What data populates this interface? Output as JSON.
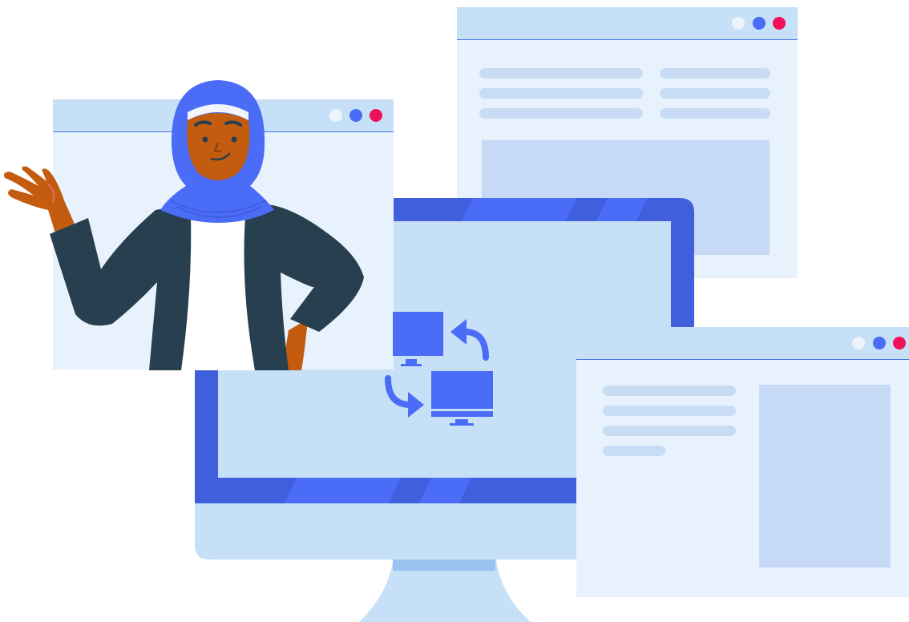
{
  "scene": {
    "windows": [
      {
        "name": "back-right-window",
        "controls": [
          "light-dot",
          "blue-dot",
          "red-dot"
        ]
      },
      {
        "name": "presenter-window",
        "controls": [
          "light-dot",
          "blue-dot",
          "red-dot"
        ]
      },
      {
        "name": "front-right-window",
        "controls": [
          "light-dot",
          "blue-dot",
          "red-dot"
        ]
      }
    ],
    "monitor": {
      "icon": "screen-sync-icon"
    },
    "person": {
      "icon": "waving-person-illustration"
    },
    "colors": {
      "window_bg": "#e8f2fd",
      "titlebar": "#c6e0f8",
      "accent_blue": "#4a6cf7",
      "monitor_frame": "#3f5fdc",
      "close_red": "#f0115a",
      "jacket": "#273f4e",
      "skin": "#c45c10",
      "hijab": "#4a6cf7"
    }
  }
}
